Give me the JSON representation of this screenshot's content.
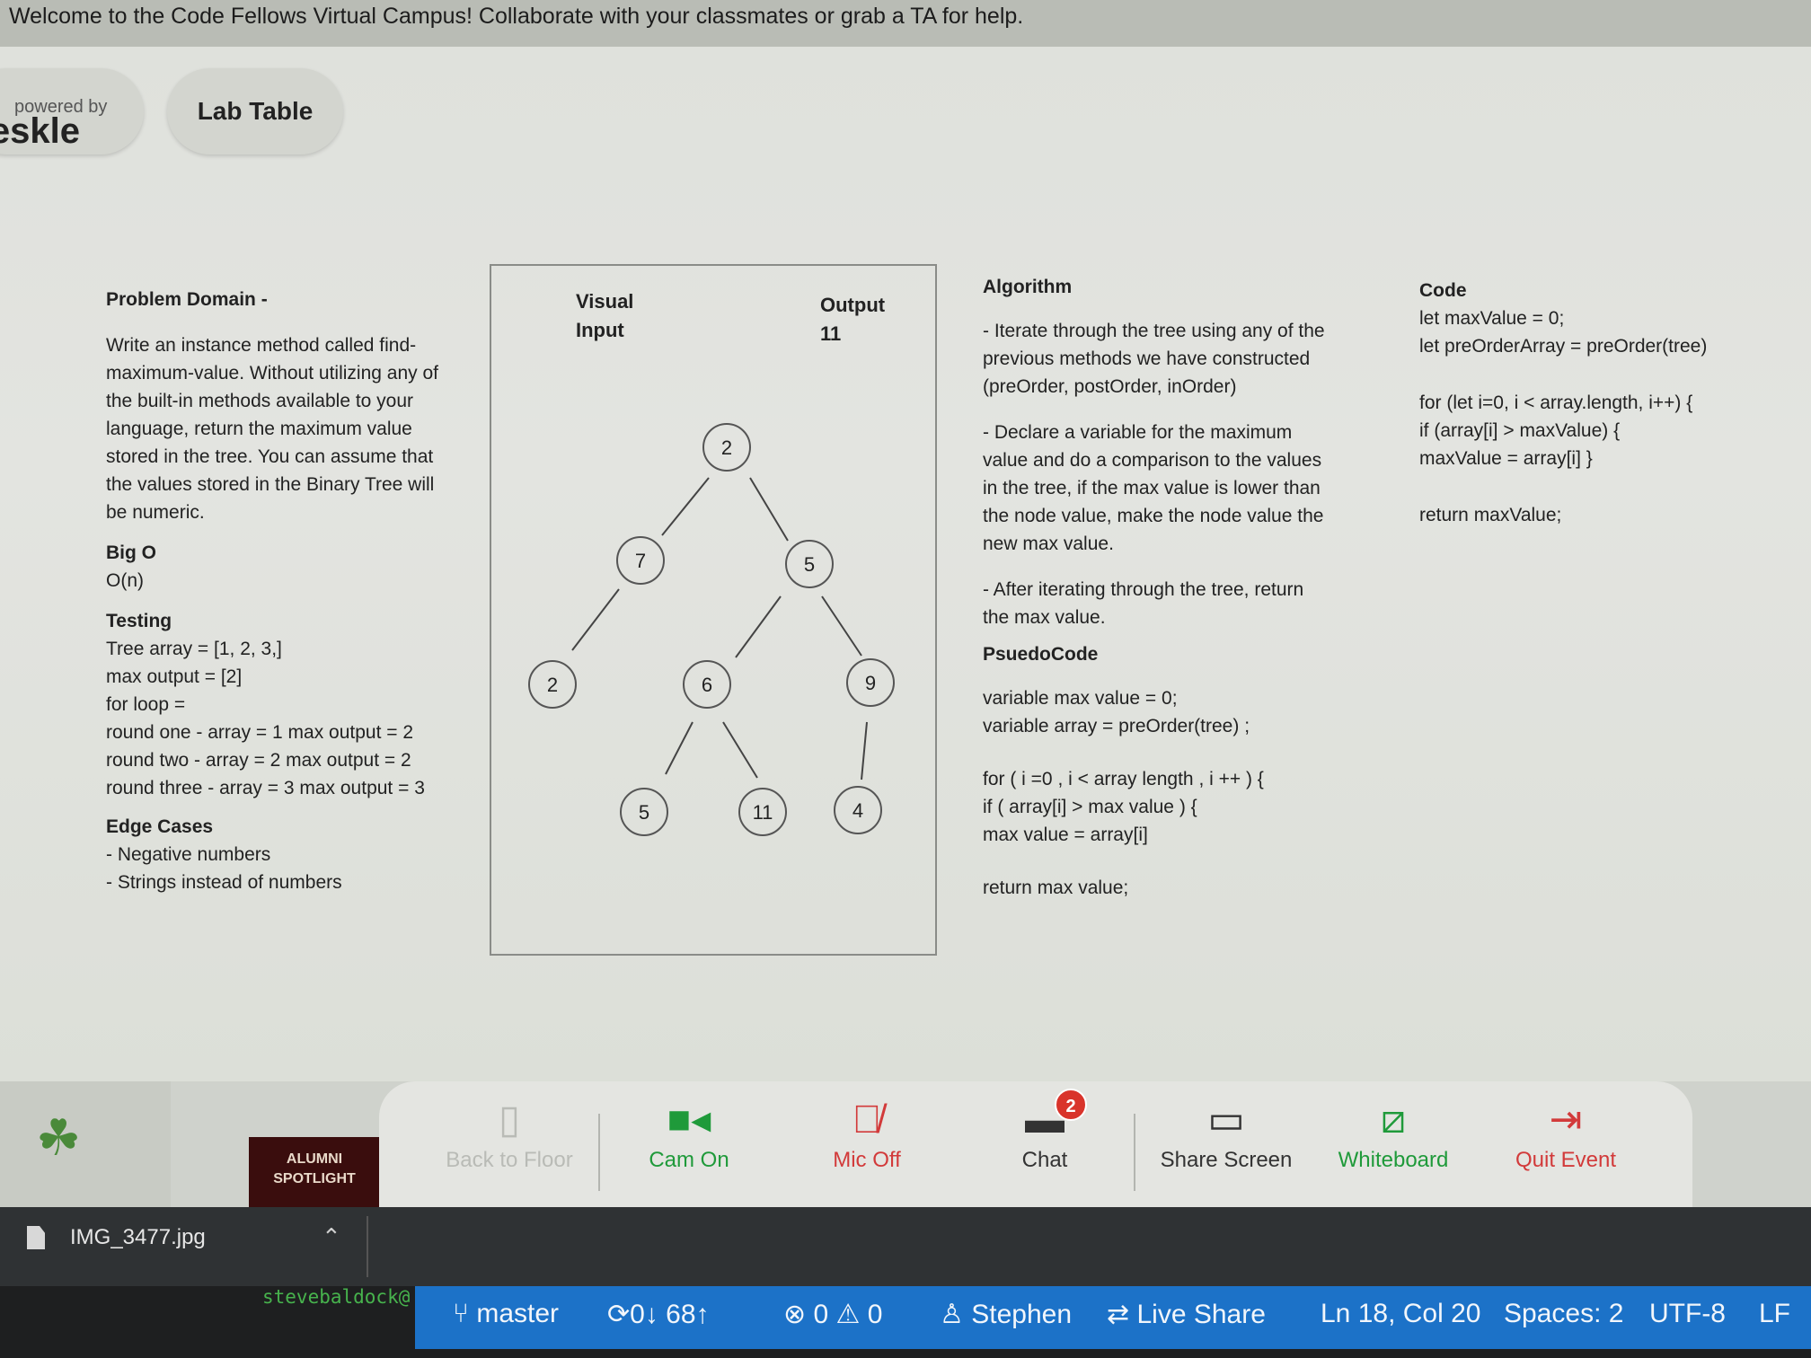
{
  "banner": {
    "text": "Welcome to the Code Fellows Virtual Campus! Collaborate with your classmates or grab a TA for help."
  },
  "brand": {
    "powered_by": "powered by",
    "name": "Deskle"
  },
  "room": {
    "label": "Lab Table"
  },
  "whiteboard": {
    "problem": {
      "heading": "Problem Domain -",
      "body": [
        "Write an instance method called find-",
        "maximum-value. Without utilizing any of",
        "the built-in methods available to your",
        "language, return the maximum value",
        "stored in the tree. You can assume that",
        "the values stored in the Binary Tree will",
        "be numeric."
      ]
    },
    "bigo": {
      "heading": "Big O",
      "value": "O(n)"
    },
    "testing": {
      "heading": "Testing",
      "lines": [
        "Tree array = [1, 2, 3,]",
        "max output = [2]",
        "for loop =",
        "round one - array = 1 max output = 2",
        "round two - array = 2 max output = 2",
        "round three - array = 3 max output = 3"
      ]
    },
    "edge": {
      "heading": "Edge Cases",
      "lines": [
        "- Negative numbers",
        "- Strings instead of numbers"
      ]
    },
    "visual": {
      "visual_label": "Visual",
      "input_label": "Input",
      "output_label": "Output",
      "output_value": "11",
      "nodes": [
        "2",
        "7",
        "5",
        "2",
        "6",
        "9",
        "5",
        "11",
        "4"
      ]
    },
    "algorithm": {
      "heading": "Algorithm",
      "steps": [
        [
          "- Iterate through the tree using any of the",
          "previous methods we have constructed",
          "(preOrder, postOrder, inOrder)"
        ],
        [
          "- Declare a variable for the maximum",
          "value and do a comparison to the values",
          "in the tree, if the max value is lower than",
          "the node value, make the node value the",
          "new max value."
        ],
        [
          "- After iterating through the tree, return",
          "the max value."
        ]
      ]
    },
    "pseudocode": {
      "heading": "PsuedoCode",
      "lines": [
        "variable max value = 0;",
        "variable array = preOrder(tree) ;",
        "",
        "for ( i =0 , i < array length , i ++ ) {",
        "if ( array[i] > max value ) {",
        "max value = array[i]",
        "",
        "return max value;"
      ]
    },
    "code": {
      "heading": "Code",
      "lines": [
        "let maxValue = 0;",
        "let preOrderArray = preOrder(tree)",
        "",
        "for (let i=0, i < array.length, i++) {",
        "if (array[i] > maxValue) {",
        "maxValue = array[i] }",
        "",
        "return maxValue;"
      ]
    }
  },
  "toolbar": {
    "spotlight": "ALUMNI SPOTLIGHT",
    "back_to_floor": "Back to Floor",
    "cam": "Cam On",
    "mic": "Mic Off",
    "chat": "Chat",
    "chat_badge": "2",
    "share": "Share Screen",
    "whiteboard": "Whiteboard",
    "quit": "Quit Event"
  },
  "download": {
    "filename": "IMG_3477.jpg"
  },
  "terminal": {
    "user": "stevebaldock@"
  },
  "statusbar": {
    "branch": "master",
    "sync": "0↓ 68↑",
    "errors": "0",
    "warnings": "0",
    "user": "Stephen",
    "live_share": "Live Share",
    "position": "Ln 18, Col 20",
    "spaces": "Spaces: 2",
    "encoding": "UTF-8",
    "eol": "LF"
  },
  "colors": {
    "cam": "#1f9a3a",
    "mic": "#d23a3a",
    "whiteboard": "#1f9a3a",
    "quit": "#d23a3a",
    "statusbar": "#1c72c8"
  },
  "icons": [
    "map-icon",
    "camera-icon",
    "mic-off-icon",
    "chat-icon",
    "share-screen-icon",
    "whiteboard-icon",
    "quit-icon",
    "git-branch-icon",
    "sync-icon",
    "error-icon",
    "warning-icon",
    "person-icon",
    "live-share-icon",
    "file-icon",
    "chevron-up-icon",
    "clover-icon"
  ]
}
